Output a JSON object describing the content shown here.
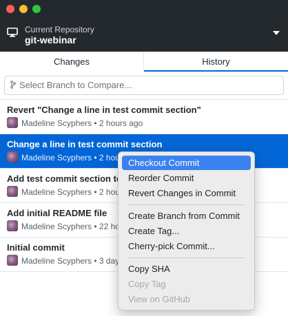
{
  "repository": {
    "label": "Current Repository",
    "name": "git-webinar"
  },
  "tabs": [
    {
      "label": "Changes",
      "active": false
    },
    {
      "label": "History",
      "active": true
    }
  ],
  "compare": {
    "placeholder": "Select Branch to Compare..."
  },
  "commits": [
    {
      "title": "Revert \"Change a line in test commit section\"",
      "meta": "Madeline Scyphers • 2 hours ago",
      "selected": false
    },
    {
      "title": "Change a line in test commit section",
      "meta": "Madeline Scyphers • 2 hou",
      "selected": true
    },
    {
      "title": "Add test commit section to",
      "meta": "Madeline Scyphers • 2 hou",
      "selected": false
    },
    {
      "title": "Add initial README file",
      "meta": "Madeline Scyphers • 22 ho",
      "selected": false
    },
    {
      "title": "Initial commit",
      "meta": "Madeline Scyphers • 3 day",
      "selected": false
    }
  ],
  "context_menu": {
    "items": [
      {
        "label": "Checkout Commit",
        "state": "highlighted"
      },
      {
        "label": "Reorder Commit",
        "state": "enabled"
      },
      {
        "label": "Revert Changes in Commit",
        "state": "enabled"
      },
      {
        "label": "Create Branch from Commit",
        "state": "enabled"
      },
      {
        "label": "Create Tag...",
        "state": "enabled"
      },
      {
        "label": "Cherry-pick Commit...",
        "state": "enabled"
      },
      {
        "label": "Copy SHA",
        "state": "enabled"
      },
      {
        "label": "Copy Tag",
        "state": "disabled"
      },
      {
        "label": "View on GitHub",
        "state": "disabled"
      }
    ]
  },
  "colors": {
    "titlebar": "#24292e",
    "accent": "#0366d6",
    "menu_highlight": "#3b82f0"
  },
  "icons": {
    "repo": "monitor-icon",
    "repo_dropdown": "chevron-down-icon",
    "compare": "branch-icon",
    "author": "avatar"
  }
}
